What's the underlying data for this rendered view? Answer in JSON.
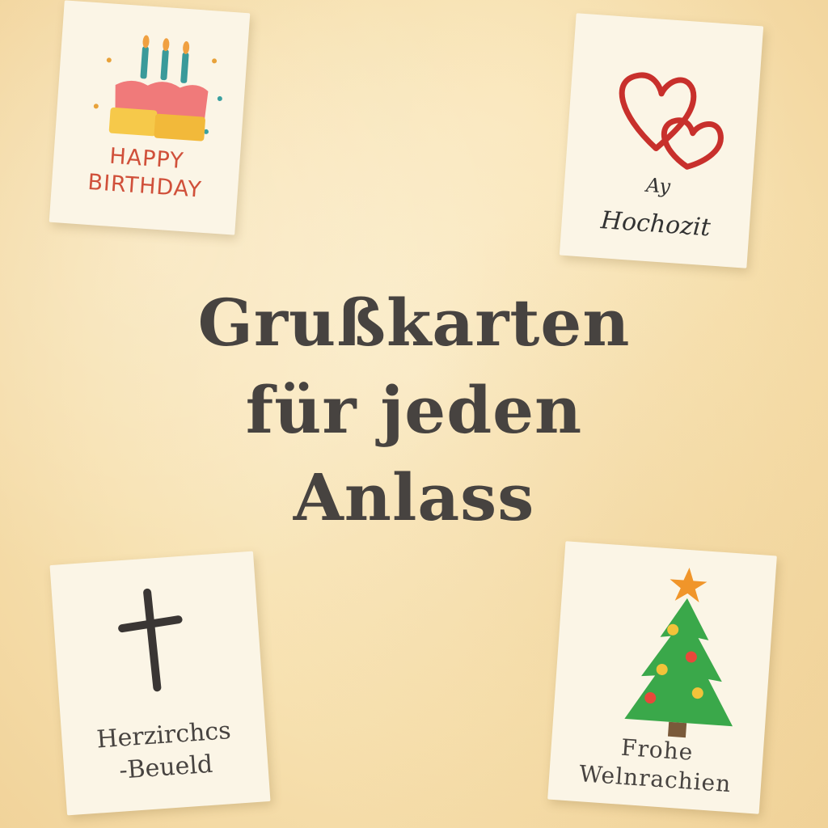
{
  "headline": {
    "line1": "Grußkarten",
    "line2": "für jeden",
    "line3": "Anlass"
  },
  "cards": {
    "birthday": {
      "line1": "HAPPY",
      "line2": "BIRTHDAY",
      "icon": "birthday-cake-icon"
    },
    "wedding": {
      "line1": "Ay",
      "line2": "Hochozit",
      "icon": "double-heart-icon"
    },
    "sympathy": {
      "line1": "Herzirchcs",
      "line2": "-Beueld",
      "icon": "cross-icon"
    },
    "christmas": {
      "line1": "Frohe",
      "line2": "Welnrachien",
      "icon": "christmas-tree-icon"
    }
  },
  "colors": {
    "background": "#f7e1b0",
    "headline": "#474340",
    "card": "#fbf5e6",
    "birthday_text": "#d0503a",
    "heart": "#c8302c",
    "tree": "#3aa84a"
  }
}
